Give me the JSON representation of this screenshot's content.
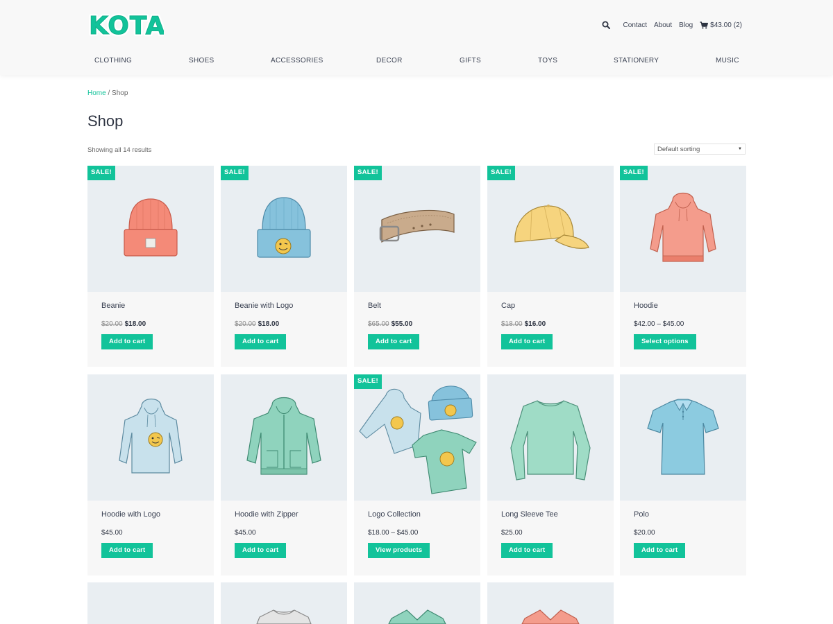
{
  "header": {
    "logo_text": "KOTA",
    "top_links": [
      "Contact",
      "About",
      "Blog"
    ],
    "cart_total": "$43.00",
    "cart_count": "(2)"
  },
  "categories": [
    "CLOTHING",
    "SHOES",
    "ACCESSORIES",
    "DECOR",
    "GIFTS",
    "TOYS",
    "STATIONERY",
    "MUSIC"
  ],
  "breadcrumb": {
    "home": "Home",
    "separator": " / ",
    "current": "Shop"
  },
  "page_title": "Shop",
  "results_text": "Showing all 14 results",
  "sorting": {
    "selected": "Default sorting"
  },
  "sale_label": "SALE!",
  "products": [
    {
      "name": "Beanie",
      "old_price": "$20.00",
      "price": "$18.00",
      "button": "Add to cart",
      "sale": true,
      "icon": "beanie-orange-icon"
    },
    {
      "name": "Beanie with Logo",
      "old_price": "$20.00",
      "price": "$18.00",
      "button": "Add to cart",
      "sale": true,
      "icon": "beanie-blue-icon"
    },
    {
      "name": "Belt",
      "old_price": "$65.00",
      "price": "$55.00",
      "button": "Add to cart",
      "sale": true,
      "icon": "belt-icon"
    },
    {
      "name": "Cap",
      "old_price": "$18.00",
      "price": "$16.00",
      "button": "Add to cart",
      "sale": true,
      "icon": "cap-icon"
    },
    {
      "name": "Hoodie",
      "old_price": "",
      "price": "$42.00 – $45.00",
      "button": "Select options",
      "sale": true,
      "icon": "hoodie-pink-icon"
    },
    {
      "name": "Hoodie with Logo",
      "old_price": "",
      "price": "$45.00",
      "button": "Add to cart",
      "sale": false,
      "icon": "hoodie-blue-icon"
    },
    {
      "name": "Hoodie with Zipper",
      "old_price": "",
      "price": "$45.00",
      "button": "Add to cart",
      "sale": false,
      "icon": "hoodie-zipper-icon"
    },
    {
      "name": "Logo Collection",
      "old_price": "",
      "price": "$18.00 – $45.00",
      "button": "View products",
      "sale": true,
      "icon": "logo-collection-icon"
    },
    {
      "name": "Long Sleeve Tee",
      "old_price": "",
      "price": "$25.00",
      "button": "Add to cart",
      "sale": false,
      "icon": "long-sleeve-tee-icon"
    },
    {
      "name": "Polo",
      "old_price": "",
      "price": "$20.00",
      "button": "Add to cart",
      "sale": false,
      "icon": "polo-icon"
    }
  ],
  "colors": {
    "accent": "#12c39a",
    "card_bg": "#f7f7f7",
    "image_bg": "#e9eef2",
    "text": "#3a4152"
  }
}
